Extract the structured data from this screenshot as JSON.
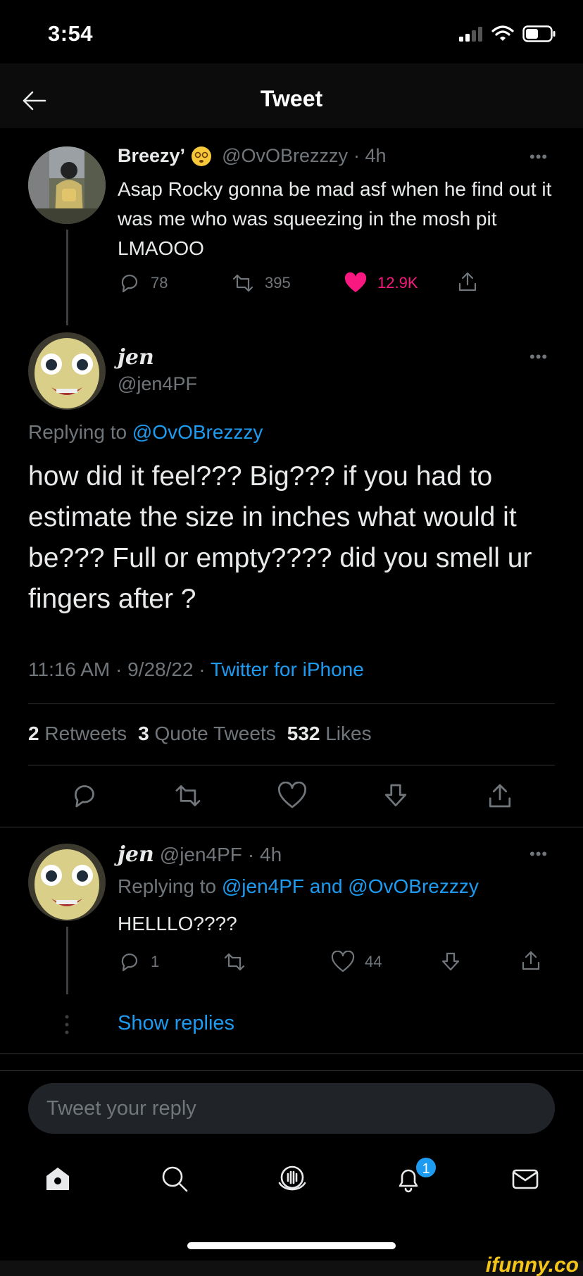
{
  "status_bar": {
    "time": "3:54"
  },
  "header": {
    "title": "Tweet"
  },
  "parent_tweet": {
    "name": "Breezy’",
    "handle": "@OvOBrezzzy",
    "time": "· 4h",
    "text": "Asap Rocky gonna be mad asf when he find out it was me who was squeezing in the mosh pit LMAOOO",
    "replies": "78",
    "retweets": "395",
    "likes": "12.9K"
  },
  "main_tweet": {
    "name": "jen",
    "handle": "@jen4PF",
    "replying_prefix": "Replying to",
    "replying_to": "@OvOBrezzzy",
    "text": "how did it feel??? Big??? if you had to estimate the size in inches what would it be??? Full or empty???? did you smell ur fingers after ?",
    "timestamp": "11:16 AM · 9/28/22 · ",
    "source": "Twitter for iPhone",
    "stats": {
      "retweets_count": "2",
      "retweets_label": "Retweets",
      "quotes_count": "3",
      "quotes_label": "Quote Tweets",
      "likes_count": "532",
      "likes_label": "Likes"
    }
  },
  "reply_tweet": {
    "name": "jen",
    "handle": "@jen4PF",
    "time": "· 4h",
    "replying_prefix": "Replying to",
    "replying_to_1": "@jen4PF",
    "and": "and",
    "replying_to_2": "@OvOBrezzzy",
    "text": "HELLLO????",
    "replies": "1",
    "likes": "44"
  },
  "show_replies": "Show replies",
  "reply_input": {
    "placeholder": "Tweet your reply"
  },
  "tab_bar": {
    "notifications_badge": "1"
  },
  "watermark": "ifunny.co",
  "colors": {
    "accent": "#1d9bf0",
    "like": "#f91880",
    "muted": "#71767b",
    "text": "#e7e9ea"
  }
}
